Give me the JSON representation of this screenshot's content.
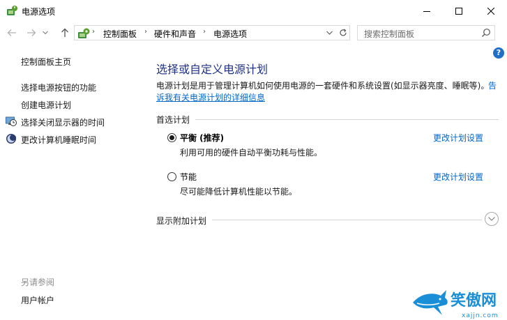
{
  "window": {
    "title": "电源选项",
    "min_icon": "minimize-icon",
    "max_icon": "maximize-icon",
    "close_icon": "close-icon"
  },
  "address_bar": {
    "breadcrumbs": [
      "控制面板",
      "硬件和声音",
      "电源选项"
    ],
    "separator": "›",
    "search_placeholder": "搜索控制面板"
  },
  "help": {
    "label": "?"
  },
  "left_pane": {
    "home": "控制面板主页",
    "links": [
      {
        "label": "选择电源按钮的功能",
        "icon": ""
      },
      {
        "label": "创建电源计划",
        "icon": ""
      },
      {
        "label": "选择关闭显示器的时间",
        "icon": "monitor-clock-icon"
      },
      {
        "label": "更改计算机睡眠时间",
        "icon": "moon-icon"
      }
    ],
    "see_also": "另请参阅",
    "user_accounts": "用户帐户"
  },
  "main": {
    "title": "选择或自定义电源计划",
    "description": "电源计划是用于管理计算机如何使用电源的一套硬件和系统设置(如显示器亮度、睡眠等)。",
    "link_line1": "告",
    "link_line2": "诉我有关电源计划的详细信息",
    "preferred_plans_header": "首选计划",
    "plans": [
      {
        "name": "平衡 (推荐)",
        "desc": "利用可用的硬件自动平衡功耗与性能。",
        "selected": true,
        "link": "更改计划设置"
      },
      {
        "name": "节能",
        "desc": "尽可能降低计算机性能以节能。",
        "selected": false,
        "link": "更改计划设置"
      }
    ],
    "additional_plans_header": "显示附加计划"
  },
  "watermark": {
    "text": "笑傲网",
    "url": "xajjn.com"
  },
  "colors": {
    "title_blue": "#1e3287",
    "link_blue": "#0066cc",
    "accent": "#1f6fc6"
  }
}
